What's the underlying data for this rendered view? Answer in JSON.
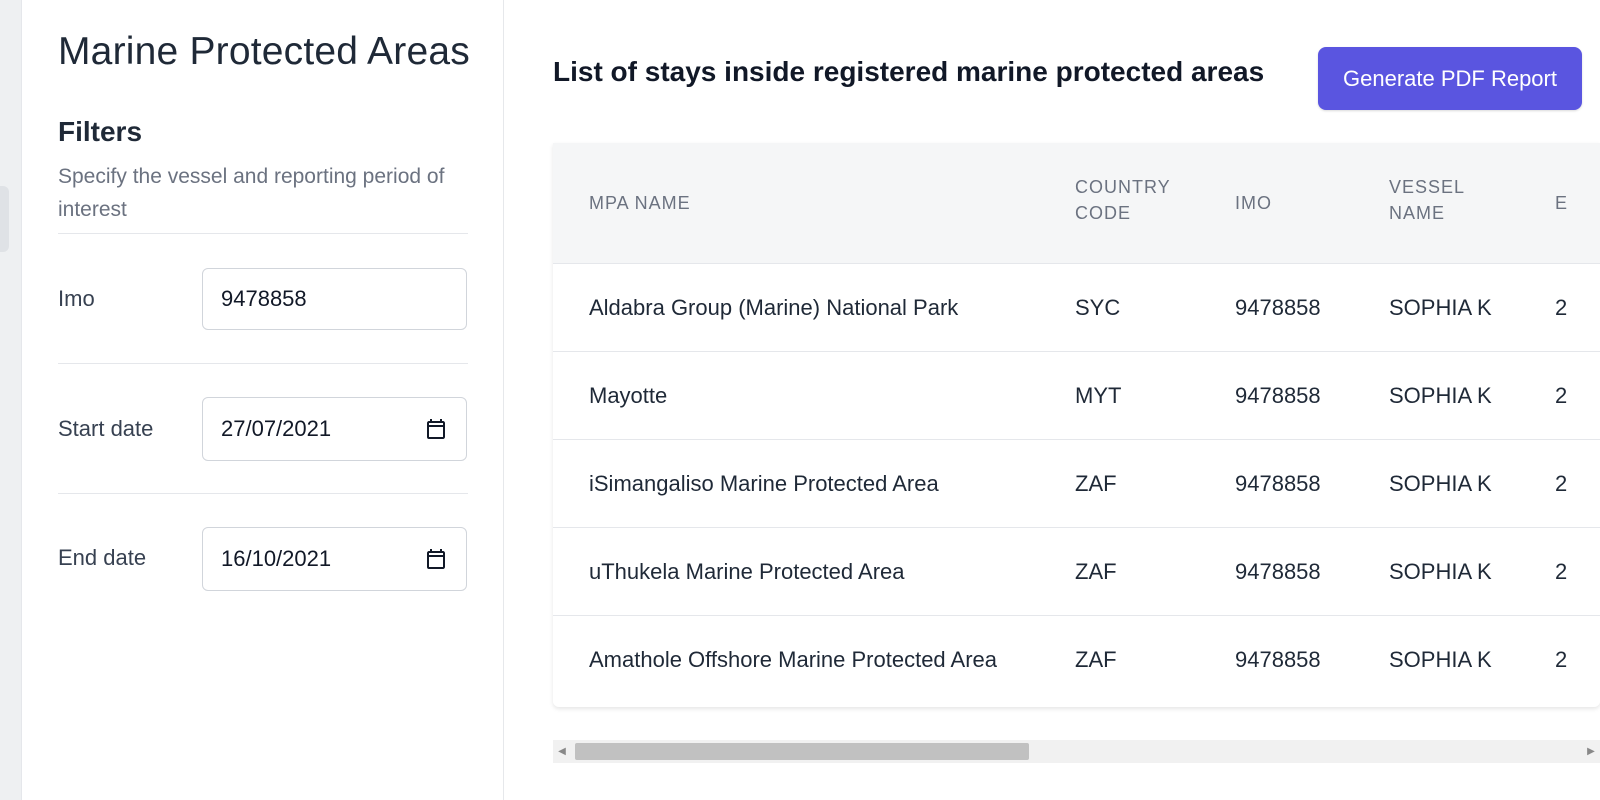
{
  "sidebar": {
    "title": "Marine Protected Areas",
    "filters_heading": "Filters",
    "filters_description": "Specify the vessel and reporting period of interest",
    "fields": {
      "imo": {
        "label": "Imo",
        "value": "9478858"
      },
      "start_date": {
        "label": "Start date",
        "value": "27/07/2021"
      },
      "end_date": {
        "label": "End date",
        "value": "16/10/2021"
      }
    }
  },
  "main": {
    "title": "List of stays inside registered marine protected areas",
    "generate_button": "Generate PDF Report",
    "table": {
      "columns": [
        "MPA NAME",
        "COUNTRY CODE",
        "IMO",
        "VESSEL NAME",
        "E"
      ],
      "rows": [
        {
          "mpa_name": "Aldabra Group (Marine) National Park",
          "country_code": "SYC",
          "imo": "9478858",
          "vessel_name": "SOPHIA K",
          "next": "2"
        },
        {
          "mpa_name": "Mayotte",
          "country_code": "MYT",
          "imo": "9478858",
          "vessel_name": "SOPHIA K",
          "next": "2"
        },
        {
          "mpa_name": "iSimangaliso Marine Protected Area",
          "country_code": "ZAF",
          "imo": "9478858",
          "vessel_name": "SOPHIA K",
          "next": "2"
        },
        {
          "mpa_name": "uThukela Marine Protected Area",
          "country_code": "ZAF",
          "imo": "9478858",
          "vessel_name": "SOPHIA K",
          "next": "2"
        },
        {
          "mpa_name": "Amathole Offshore Marine Protected Area",
          "country_code": "ZAF",
          "imo": "9478858",
          "vessel_name": "SOPHIA K",
          "next": "2"
        }
      ]
    },
    "scroll_position": 0
  },
  "icons": {
    "calendar": "calendar-icon",
    "scroll_left": "arrow-left-icon",
    "scroll_right": "arrow-right-icon"
  },
  "colors": {
    "accent": "#5a55e0",
    "header_bg": "#f5f6f7",
    "muted_text": "#6b7280"
  }
}
